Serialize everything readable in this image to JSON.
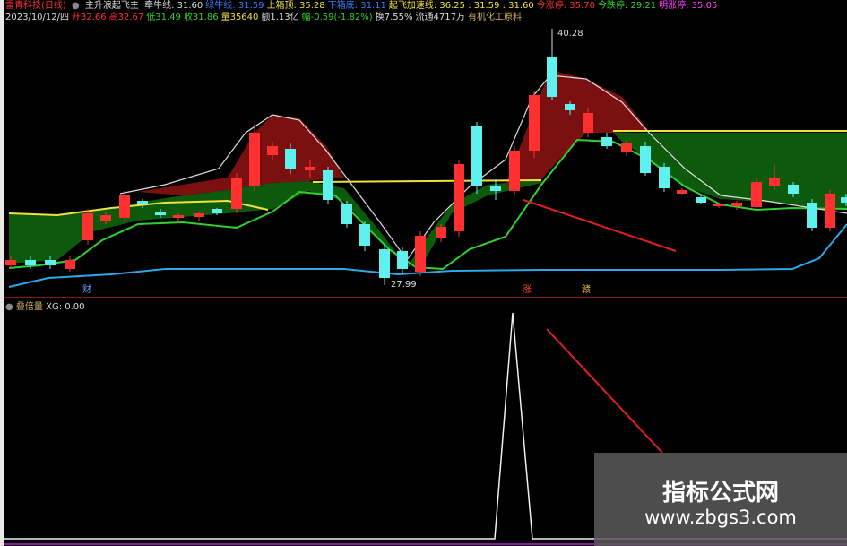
{
  "header1": {
    "stock": "雷青科技(日线)",
    "mode": "主升浪起飞主",
    "items": [
      {
        "label": "牵牛线: 31.60",
        "color": "#dddddd"
      },
      {
        "label": "绿牛线: 31.59",
        "color": "#3a7dff"
      },
      {
        "label": "上箱顶: 35.28",
        "color": "#f0e040"
      },
      {
        "label": "下箱底: 31.11",
        "color": "#3a7dff"
      },
      {
        "label": "起飞加速线: 36.25 : 31.59 : 31.60",
        "color": "#f0e040"
      },
      {
        "label": "今涨停: 35.70",
        "color": "#ff3030"
      },
      {
        "label": "今跌停: 29.21",
        "color": "#30d030"
      },
      {
        "label": "明涨停: 35.05",
        "color": "#ff40ff"
      }
    ]
  },
  "header2": {
    "items": [
      {
        "label": "2023/10/12/四",
        "color": "#dddddd"
      },
      {
        "label": "开32.66",
        "color": "#ff3030"
      },
      {
        "label": "高32.67",
        "color": "#ff3030"
      },
      {
        "label": "低31.49",
        "color": "#30d030"
      },
      {
        "label": "收31.86",
        "color": "#30d030"
      },
      {
        "label": "量35640",
        "color": "#f0e040"
      },
      {
        "label": "额1.13亿",
        "color": "#dddddd"
      },
      {
        "label": "幅-0.59(-1.82%)",
        "color": "#30d030"
      },
      {
        "label": "换7.55%",
        "color": "#dddddd"
      },
      {
        "label": "流通4717万",
        "color": "#dddddd"
      },
      {
        "label": "有机化工原料",
        "color": "#d0b060"
      }
    ]
  },
  "main_chart": {
    "high_label": "40.28",
    "low_label": "27.99",
    "marks": [
      {
        "label": "财",
        "color": "#6fa0ff"
      },
      {
        "label": "涨",
        "color": "#ff4040"
      },
      {
        "label": "赣",
        "color": "#f0c040"
      }
    ]
  },
  "sub_chart": {
    "title": "叠倍量",
    "value_label": "XG: 0.00"
  },
  "watermark": {
    "title": "指标公式网",
    "url": "www.zbgs3.com"
  },
  "colors": {
    "up": "#ff3030",
    "down": "#5ff0f0",
    "red_fill": "#7a1010",
    "green_fill": "#0d5a0d",
    "box_top": "#f0e040",
    "green_line": "#30d030",
    "blue_line": "#2aa8e8",
    "white_line": "#dddddd",
    "arrow": "#e02020"
  }
}
